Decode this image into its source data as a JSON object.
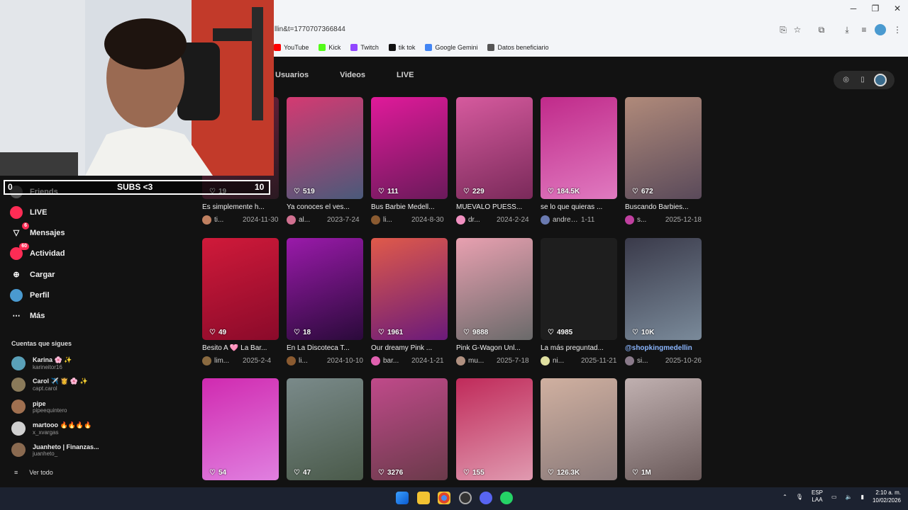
{
  "browser": {
    "url": "llin&t=1770707366844",
    "bookmarks": [
      {
        "label": "YouTube",
        "icon": "youtube-icon",
        "color": "#ff0000"
      },
      {
        "label": "Kick",
        "icon": "kick-icon",
        "color": "#53fc18"
      },
      {
        "label": "Twitch",
        "icon": "twitch-icon",
        "color": "#9146ff"
      },
      {
        "label": "tik tok",
        "icon": "tiktok-icon",
        "color": "#111111"
      },
      {
        "label": "Google Gemini",
        "icon": "gemini-icon",
        "color": "#4285f4"
      },
      {
        "label": "Datos beneficiario",
        "icon": "globe-icon",
        "color": "#555555"
      }
    ]
  },
  "tabs": [
    "Usuarios",
    "Videos",
    "LIVE"
  ],
  "overlay": {
    "subs_left": "0",
    "subs_text": "SUBS <3",
    "subs_right": "10"
  },
  "sidebar": {
    "items": [
      {
        "label": "Friends",
        "icon": "friends-icon"
      },
      {
        "label": "LIVE",
        "icon": "live-icon"
      },
      {
        "label": "Mensajes",
        "icon": "messages-icon",
        "badge": "6"
      },
      {
        "label": "Actividad",
        "icon": "activity-icon",
        "badge": "60"
      },
      {
        "label": "Cargar",
        "icon": "upload-icon"
      },
      {
        "label": "Perfil",
        "icon": "profile-icon"
      },
      {
        "label": "Más",
        "icon": "more-icon"
      }
    ],
    "following_title": "Cuentas que sigues",
    "accounts": [
      {
        "name": "Karina 🌸 ✨",
        "handle": "karineitor16",
        "color": "#5aa0b8"
      },
      {
        "name": "Carol ✈️ 👸 🌸 ✨",
        "handle": "capt.carol",
        "color": "#8a7a5a"
      },
      {
        "name": "pipe",
        "handle": "pipeequintero",
        "color": "#a07050"
      },
      {
        "name": "martooo 🔥🔥🔥🔥",
        "handle": "x_xvargas",
        "color": "#d0d0d0"
      },
      {
        "name": "Juanheto | Finanzas...",
        "handle": "juanheto_",
        "color": "#8a6a50"
      }
    ],
    "see_all": "Ver todo"
  },
  "videos": [
    {
      "likes": "19",
      "title": "Es simplemente h...",
      "author": "ti...",
      "date": "2024-11-30",
      "c1": "#6b1f3a",
      "c2": "#2b1a22",
      "av": "#c08060"
    },
    {
      "likes": "519",
      "title": "Ya conoces el ves...",
      "author": "al...",
      "date": "2023-7-24",
      "c1": "#d43a72",
      "c2": "#4a5a7a",
      "av": "#d07090"
    },
    {
      "likes": "111",
      "title": "Bus Barbie Medell...",
      "author": "li...",
      "date": "2024-8-30",
      "c1": "#e01a9a",
      "c2": "#6a1a5a",
      "av": "#8a5a30"
    },
    {
      "likes": "229",
      "title": "MUEVALO PUESS...",
      "author": "dr...",
      "date": "2024-2-24",
      "c1": "#d65a9e",
      "c2": "#7a2a5a",
      "av": "#f090c0"
    },
    {
      "likes": "184.5K",
      "title": "se lo que quieras ...",
      "author": "andresfo...",
      "date": "1-11",
      "c1": "#c02a8a",
      "c2": "#e07ac0",
      "av": "#6a7ab0"
    },
    {
      "likes": "672",
      "title": "Buscando Barbies...",
      "author": "s...",
      "date": "2025-12-18",
      "c1": "#b08a7a",
      "c2": "#5a4a5a",
      "av": "#c040a0"
    },
    {
      "likes": "49",
      "title": "Besito A 🩷 La Bar...",
      "author": "lim...",
      "date": "2025-2-4",
      "c1": "#d01a3a",
      "c2": "#8a0a2a",
      "av": "#8a6a40"
    },
    {
      "likes": "18",
      "title": "En La Discoteca T...",
      "author": "li...",
      "date": "2024-10-10",
      "c1": "#9a1aaa",
      "c2": "#2a0a3a",
      "av": "#8a5a30"
    },
    {
      "likes": "1961",
      "title": "Our dreamy Pink ...",
      "author": "bar...",
      "date": "2024-1-21",
      "c1": "#e05a4a",
      "c2": "#6a1a7a",
      "av": "#e060b0"
    },
    {
      "likes": "9888",
      "title": "Pink G-Wagon Unl...",
      "author": "mu...",
      "date": "2025-7-18",
      "c1": "#e8a0b0",
      "c2": "#6a6a6a",
      "av": "#b09080"
    },
    {
      "likes": "4985",
      "title": "La más preguntad...",
      "author": "ni...",
      "date": "2025-11-21",
      "c1": "#1e1e1e",
      "c2": "#1e1e1e",
      "av": "#e0e0a0"
    },
    {
      "likes": "10K",
      "title": "@shopkingmedellin",
      "author": "si...",
      "date": "2025-10-26",
      "c1": "#3a3a4a",
      "c2": "#7a8a9a",
      "av": "#8a7a8a",
      "tag": true
    },
    {
      "likes": "54",
      "title": "",
      "author": "",
      "date": "",
      "c1": "#d02ab0",
      "c2": "#e080e0",
      "av": "#555"
    },
    {
      "likes": "47",
      "title": "",
      "author": "",
      "date": "",
      "c1": "#7a8a8a",
      "c2": "#4a5a4a",
      "av": "#555"
    },
    {
      "likes": "3276",
      "title": "",
      "author": "",
      "date": "",
      "c1": "#c04a8a",
      "c2": "#6a3a4a",
      "av": "#555"
    },
    {
      "likes": "155",
      "title": "",
      "author": "",
      "date": "",
      "c1": "#c02a5a",
      "c2": "#e09ab0",
      "av": "#555"
    },
    {
      "likes": "126.3K",
      "title": "",
      "author": "",
      "date": "",
      "c1": "#d0b0a0",
      "c2": "#8a7a7a",
      "av": "#555"
    },
    {
      "likes": "1M",
      "title": "",
      "author": "",
      "date": "",
      "c1": "#c0b0b0",
      "c2": "#6a5a5a",
      "av": "#555"
    }
  ],
  "taskbar": {
    "lang_top": "ESP",
    "lang_bottom": "LAA",
    "time": "2:10 a. m.",
    "date": "10/02/2026"
  }
}
